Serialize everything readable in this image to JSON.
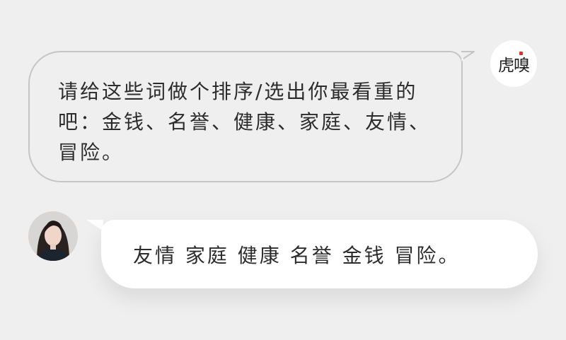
{
  "brand": {
    "logo_text": "虎嗅",
    "accent_color": "#e0322e"
  },
  "conversation": {
    "question": "请给这些词做个排序/选出你最看重的吧：金钱、名誉、健康、家庭、友情、冒险。",
    "answer": "友情 家庭 健康 名誉 金钱 冒险。"
  },
  "icons": {
    "logo": "huxiu-logo-icon",
    "user_avatar": "user-avatar-photo"
  }
}
